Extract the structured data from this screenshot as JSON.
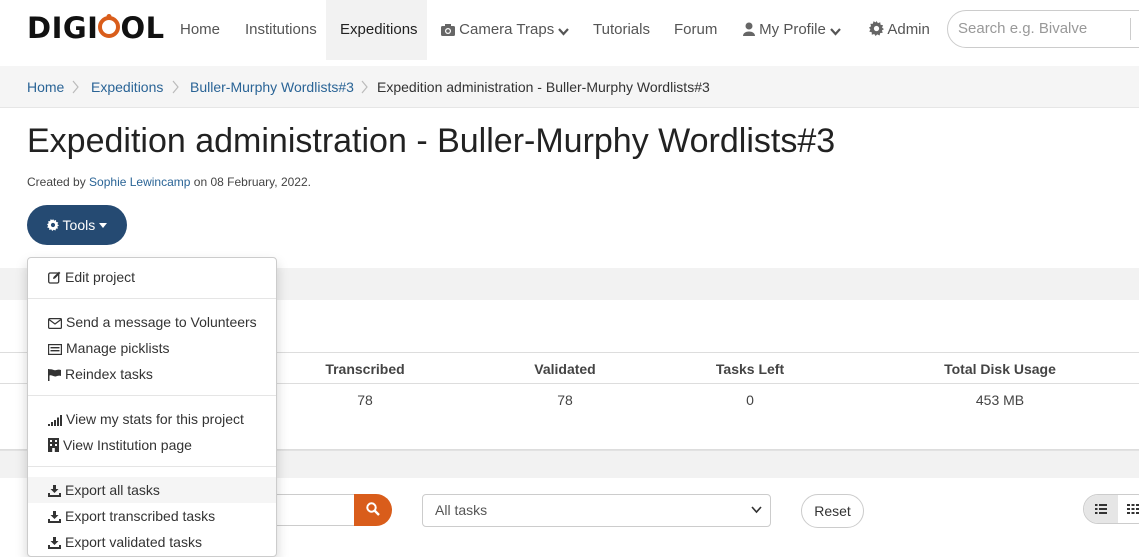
{
  "nav": {
    "logo_left": "DIGI",
    "logo_o": "V",
    "logo_right": "OL",
    "items": [
      "Home",
      "Institutions",
      "Expeditions",
      "Camera Traps",
      "Tutorials",
      "Forum",
      "My Profile",
      "Admin"
    ],
    "search_placeholder": "Search e.g. Bivalve"
  },
  "breadcrumb": [
    "Home",
    "Expeditions",
    "Buller-Murphy Wordlists#3",
    "Expedition administration - Buller-Murphy Wordlists#3"
  ],
  "page": {
    "title": "Expedition administration - Buller-Murphy Wordlists#3",
    "created_prefix": "Created by",
    "created_by": "Sophie Lewincamp",
    "created_suffix": "on 08 February, 2022.",
    "tools_label": "Tools"
  },
  "stats": {
    "headers": [
      "Transcribed",
      "Validated",
      "Tasks Left",
      "Total Disk Usage"
    ],
    "values": [
      "78",
      "78",
      "0",
      "453 MB"
    ]
  },
  "filters": {
    "select_value": "All tasks",
    "reset_label": "Reset"
  },
  "tools_menu": {
    "items": [
      {
        "label": "Edit project",
        "icon": "edit-icon"
      },
      {
        "label": "Send a message to Volunteers",
        "icon": "envelope-icon"
      },
      {
        "label": "Manage picklists",
        "icon": "list-icon"
      },
      {
        "label": "Reindex tasks",
        "icon": "flag-icon"
      },
      {
        "label": "View my stats for this project",
        "icon": "signal-icon"
      },
      {
        "label": "View Institution page",
        "icon": "building-icon"
      },
      {
        "label": "Export all tasks",
        "icon": "download-icon"
      },
      {
        "label": "Export transcribed tasks",
        "icon": "download-icon"
      },
      {
        "label": "Export validated tasks",
        "icon": "download-icon"
      }
    ]
  },
  "colors": {
    "accent": "#d95d1b",
    "primary": "#254a72",
    "link": "#2a6496"
  }
}
